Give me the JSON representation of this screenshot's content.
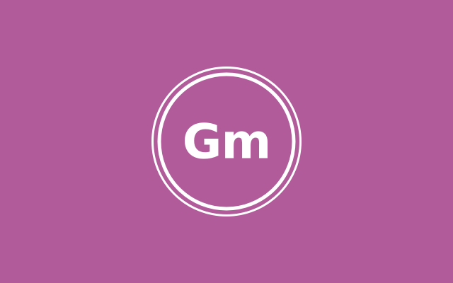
{
  "logo": {
    "text": "Gm",
    "background_color": "#b25b9b",
    "foreground_color": "#ffffff"
  }
}
